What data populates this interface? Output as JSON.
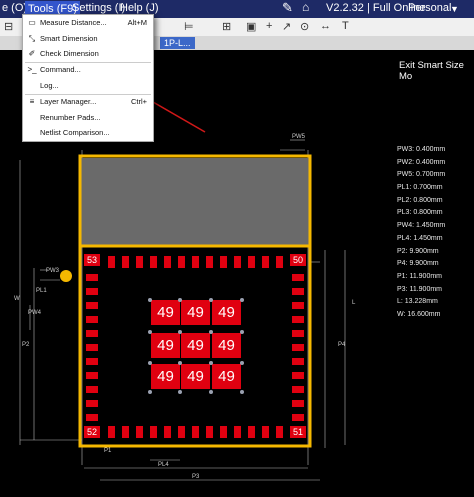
{
  "menubar": {
    "items": [
      "e (O)",
      "Tools (F9)",
      "Settings (I)",
      "Help (J)"
    ],
    "version": "V2.2.32 | Full Online",
    "account": "Personal"
  },
  "tab": {
    "label": "1P-L..."
  },
  "tools_menu": {
    "items": [
      {
        "label": "Measure Distance...",
        "shortcut": "Alt+M",
        "icon": "ruler-icon"
      },
      {
        "label": "Smart Dimension",
        "shortcut": "",
        "icon": "smart-dimension-icon"
      },
      {
        "label": "Check Dimension",
        "shortcut": "",
        "icon": "check-dimension-icon"
      },
      {
        "label": "Command...",
        "shortcut": "",
        "icon": "command-icon"
      },
      {
        "label": "Log...",
        "shortcut": "",
        "icon": ""
      },
      {
        "label": "Layer Manager...",
        "shortcut": "Ctrl+",
        "icon": "layer-icon"
      },
      {
        "label": "Renumber Pads...",
        "shortcut": "",
        "icon": ""
      },
      {
        "label": "Netlist Comparison...",
        "shortcut": "",
        "icon": ""
      }
    ]
  },
  "canvas": {
    "exit_label": "Exit Smart Size Mo",
    "specs": [
      "PW3: 0.400mm",
      "PW2: 0.400mm",
      "PW5: 0.700mm",
      "PL1: 0.700mm",
      "PL2: 0.800mm",
      "PL3: 0.800mm",
      "PW4: 1.450mm",
      "PL4: 1.450mm",
      "P2: 9.900mm",
      "P4: 9.900mm",
      "P1: 11.900mm",
      "P3: 11.900mm",
      "L: 13.228mm",
      "W: 16.600mm"
    ],
    "corner_pads": {
      "top_left": "53",
      "top_right": "50",
      "bottom_left": "52",
      "bottom_right": "51"
    },
    "center_pad_label": "49",
    "dim_labels": [
      "PW5",
      "PW3",
      "PL1",
      "PW4",
      "P2",
      "P4",
      "P1",
      "PL4",
      "P3",
      "W",
      "L"
    ]
  },
  "colors": {
    "board_outline": "#f5b800",
    "pad": "#e00010",
    "menu_bg": "#1e2a66",
    "annotation_arrow": "#d01818"
  }
}
